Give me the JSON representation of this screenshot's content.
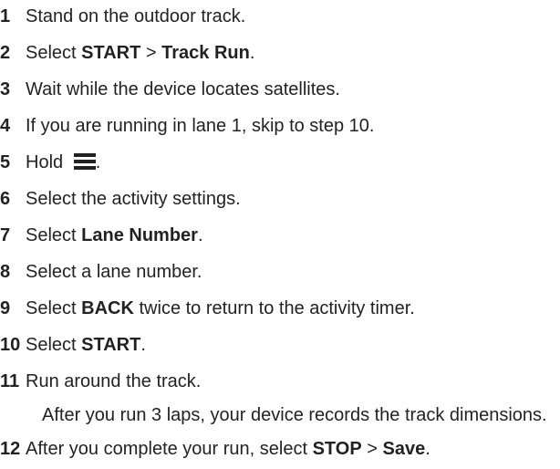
{
  "steps": [
    {
      "num": "1",
      "parts": [
        {
          "t": "Stand on the outdoor track."
        }
      ]
    },
    {
      "num": "2",
      "parts": [
        {
          "t": "Select "
        },
        {
          "t": "START",
          "b": true
        },
        {
          "t": " > "
        },
        {
          "t": "Track Run",
          "b": true
        },
        {
          "t": "."
        }
      ]
    },
    {
      "num": "3",
      "parts": [
        {
          "t": "Wait while the device locates satellites."
        }
      ]
    },
    {
      "num": "4",
      "parts": [
        {
          "t": "If you are running in lane 1, skip to step 10."
        }
      ]
    },
    {
      "num": "5",
      "parts": [
        {
          "t": "Hold "
        }
      ],
      "icon": "menu-icon",
      "after": "."
    },
    {
      "num": "6",
      "parts": [
        {
          "t": "Select the activity settings."
        }
      ]
    },
    {
      "num": "7",
      "parts": [
        {
          "t": "Select "
        },
        {
          "t": "Lane Number",
          "b": true
        },
        {
          "t": "."
        }
      ]
    },
    {
      "num": "8",
      "parts": [
        {
          "t": "Select a lane number."
        }
      ]
    },
    {
      "num": "9",
      "parts": [
        {
          "t": "Select "
        },
        {
          "t": "BACK",
          "b": true
        },
        {
          "t": " twice to return to the activity timer."
        }
      ]
    },
    {
      "num": "10",
      "parts": [
        {
          "t": "Select "
        },
        {
          "t": "START",
          "b": true
        },
        {
          "t": "."
        }
      ]
    },
    {
      "num": "11",
      "parts": [
        {
          "t": "Run around the track."
        }
      ]
    },
    {
      "num": "12",
      "parts": [
        {
          "t": "After you complete your run, select "
        },
        {
          "t": "STOP",
          "b": true
        },
        {
          "t": " > "
        },
        {
          "t": "Save",
          "b": true
        },
        {
          "t": "."
        }
      ]
    }
  ],
  "note": "After you run 3 laps, your device records the track dimensions."
}
